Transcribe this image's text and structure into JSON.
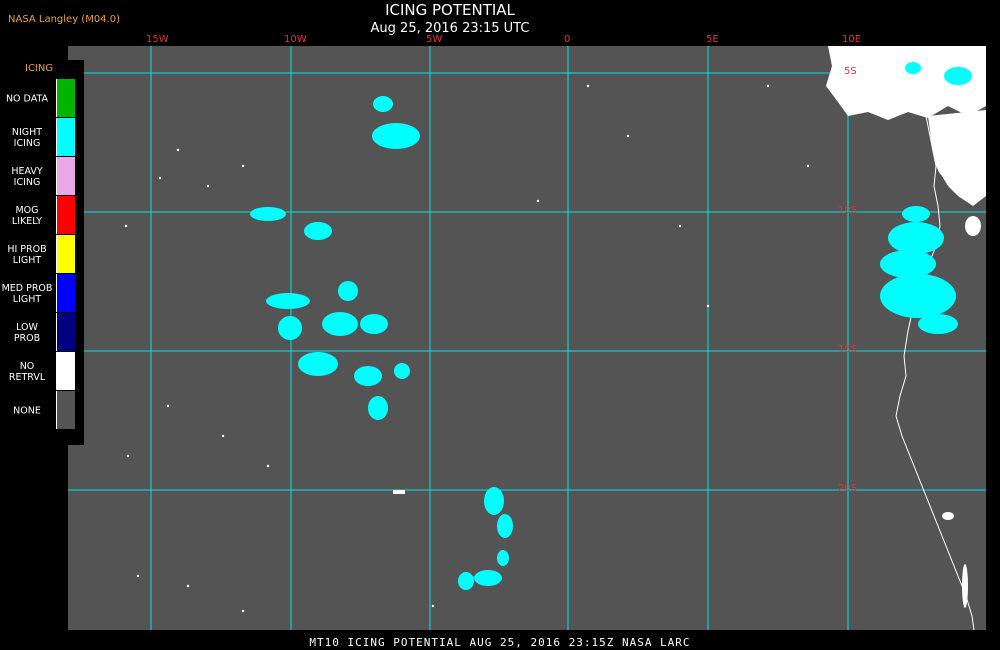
{
  "header": {
    "producer": "NASA Langley (M04.0)",
    "title": "ICING POTENTIAL",
    "timestamp": "Aug 25, 2016 23:15 UTC"
  },
  "grid": {
    "longitudes": [
      "15W",
      "10W",
      "5W",
      "0",
      "5E",
      "10E"
    ],
    "latitudes": [
      "5S",
      "10S",
      "15S",
      "20S"
    ]
  },
  "legend": {
    "title": "ICING",
    "items": [
      {
        "label": "NO DATA",
        "color": "#00b400"
      },
      {
        "label": "NIGHT\nICING",
        "color": "#00ffff"
      },
      {
        "label": "HEAVY\nICING",
        "color": "#e6a8e6"
      },
      {
        "label": "MOG\nLIKELY",
        "color": "#ff0000"
      },
      {
        "label": "HI PROB\nLIGHT",
        "color": "#ffff00"
      },
      {
        "label": "MED PROB\nLIGHT",
        "color": "#0000ff"
      },
      {
        "label": "LOW\nPROB",
        "color": "#000080"
      },
      {
        "label": "NO\nRETRVL",
        "color": "#ffffff"
      },
      {
        "label": "NONE",
        "color": "#545454"
      }
    ]
  },
  "footer": {
    "caption": "MT10   ICING POTENTIAL   AUG 25, 2016 23:15Z   NASA LARC"
  },
  "colors": {
    "background": "#545454",
    "grid_lines": "#00e5e5",
    "grid_labels": "#e0343a",
    "icing": "#00ffff",
    "no_retrieval": "#ffffff"
  }
}
